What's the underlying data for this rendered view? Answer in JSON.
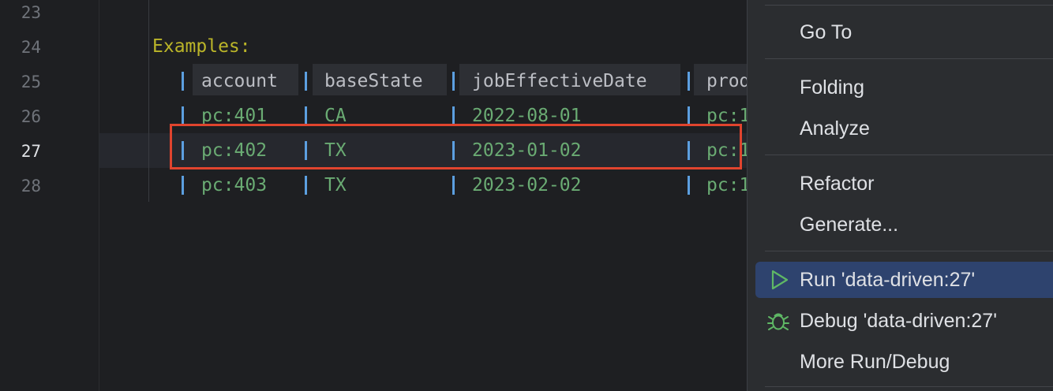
{
  "editor": {
    "line_numbers": [
      "23",
      "24",
      "25",
      "26",
      "27",
      "28"
    ],
    "keyword": "Examples:",
    "table": {
      "headers": [
        "account",
        "baseState",
        "jobEffectiveDate",
        "prod"
      ],
      "rows": [
        [
          "pc:401",
          "CA",
          "2022-08-01",
          "pc:1"
        ],
        [
          "pc:402",
          "TX",
          "2023-01-02",
          "pc:1"
        ],
        [
          "pc:403",
          "TX",
          "2023-02-02",
          "pc:1"
        ]
      ]
    }
  },
  "context_menu": {
    "items": [
      "Go To",
      "Folding",
      "Analyze",
      "Refactor",
      "Generate...",
      "Run 'data-driven:27'",
      "Debug 'data-driven:27'",
      "More Run/Debug"
    ],
    "selected_item": "Run 'data-driven:27'"
  },
  "colors": {
    "highlight_border": "#e0442e",
    "run_icon": "#5fb865",
    "debug_icon": "#5fb865",
    "selected_bg": "#2e436e"
  },
  "icons": {
    "run": "play-triangle-icon",
    "debug": "bug-icon"
  }
}
